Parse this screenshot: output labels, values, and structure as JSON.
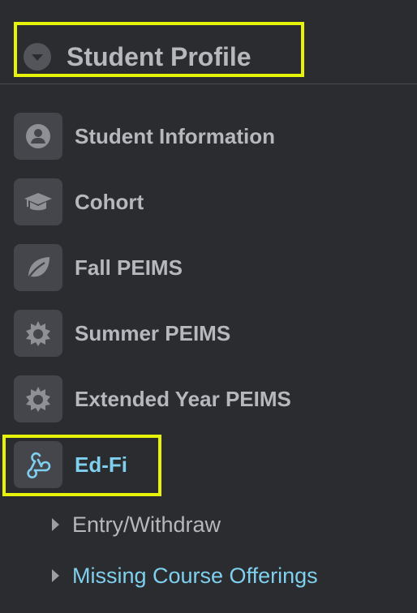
{
  "header": {
    "title": "Student Profile",
    "toggle_icon": "chevron-down-icon"
  },
  "nav": {
    "items": [
      {
        "label": "Student Information",
        "icon": "user-circle-icon"
      },
      {
        "label": "Cohort",
        "icon": "graduation-cap-icon"
      },
      {
        "label": "Fall PEIMS",
        "icon": "leaf-icon"
      },
      {
        "label": "Summer PEIMS",
        "icon": "sun-icon"
      },
      {
        "label": "Extended Year PEIMS",
        "icon": "sun-icon"
      },
      {
        "label": "Ed-Fi",
        "icon": "webhook-icon",
        "active": true
      }
    ]
  },
  "subnav": {
    "items": [
      {
        "label": "Entry/Withdraw",
        "icon": "caret-right-icon"
      },
      {
        "label": "Missing Course Offerings",
        "icon": "caret-right-icon",
        "link": true
      }
    ]
  },
  "colors": {
    "background": "#2b2c30",
    "icon_box": "#44464c",
    "text": "#b6b8bd",
    "accent": "#7fd0ee",
    "highlight": "#e6f20a"
  }
}
